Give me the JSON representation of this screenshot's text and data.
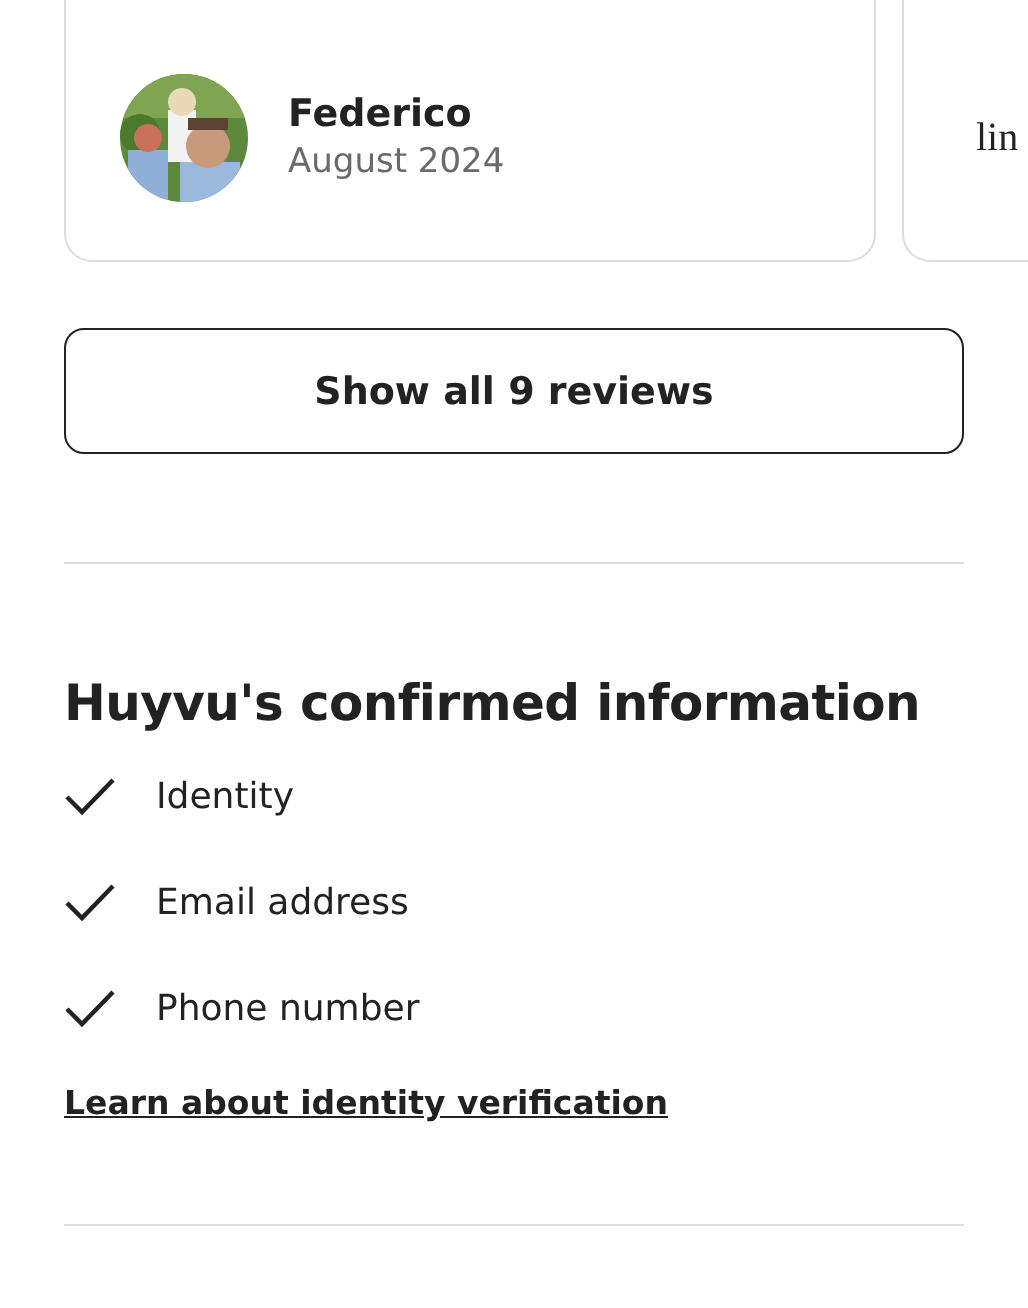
{
  "reviews": [
    {
      "kind": "review",
      "name": "Federico",
      "date": "August 2024"
    },
    {
      "kind": "partial",
      "text": "lin"
    }
  ],
  "show_all_button": "Show all 9 reviews",
  "confirmed": {
    "title": "Huyvu's confirmed information",
    "items": [
      {
        "label": "Identity",
        "checked": true
      },
      {
        "label": "Email address",
        "checked": true
      },
      {
        "label": "Phone number",
        "checked": true
      }
    ],
    "link": "Learn about identity verification"
  }
}
